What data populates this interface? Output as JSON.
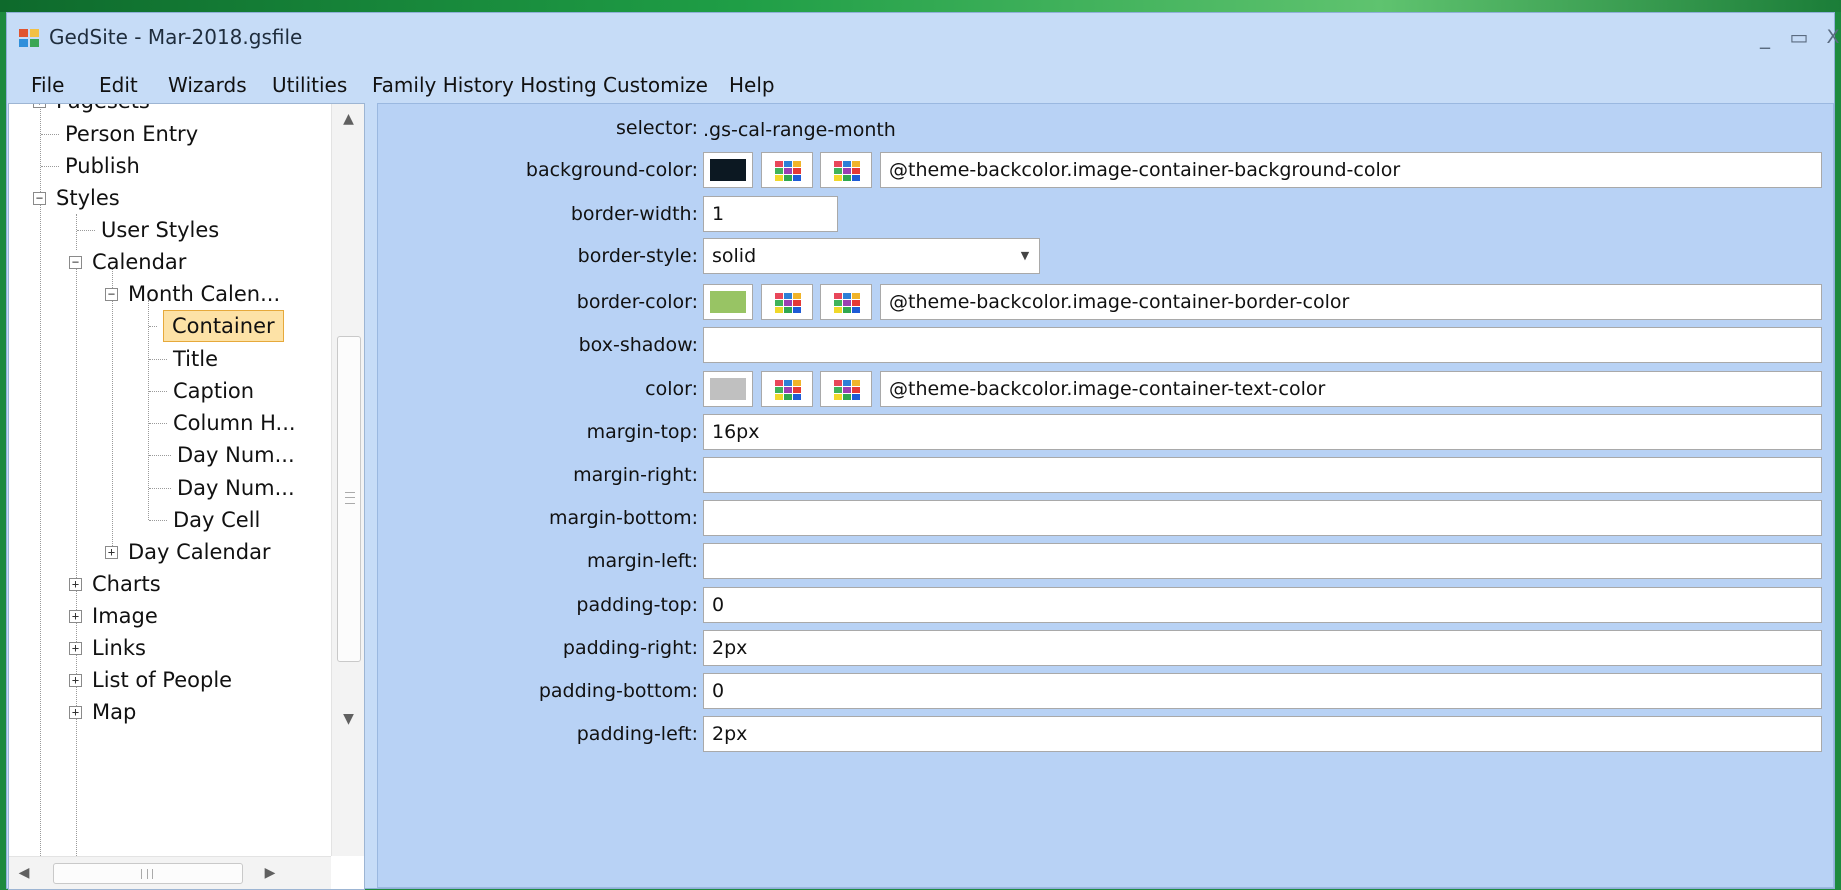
{
  "window": {
    "title": "GedSite - Mar-2018.gsfile",
    "minimize_glyph": "_",
    "maximize_glyph": "▭",
    "close_glyph": "X"
  },
  "menu": [
    "File",
    "Edit",
    "Wizards",
    "Utilities",
    "Family History Hosting",
    "Customize",
    "Help"
  ],
  "tree": {
    "partial_top": "Pagesets",
    "items": {
      "person_entry": "Person Entry",
      "publish": "Publish",
      "styles": "Styles",
      "user_styles": "User Styles",
      "calendar": "Calendar",
      "month_calendar": "Month Calen...",
      "container": "Container",
      "title": "Title",
      "caption": "Caption",
      "column_h": "Column H...",
      "day_num_1": "Day Num...",
      "day_num_2": "Day Num...",
      "day_cell": "Day Cell",
      "day_calendar": "Day Calendar",
      "charts": "Charts",
      "image": "Image",
      "links": "Links",
      "list_of_people": "List of People",
      "map": "Map"
    },
    "expanded_glyph": "−",
    "collapsed_glyph": "+"
  },
  "properties": {
    "selector_label": "selector:",
    "selector_value": ".gs-cal-range-month",
    "background_color": {
      "label": "background-color:",
      "swatch": "#0c1822",
      "value": "@theme-backcolor.image-container-background-color"
    },
    "border_width": {
      "label": "border-width:",
      "value": "1"
    },
    "border_style": {
      "label": "border-style:",
      "value": "solid"
    },
    "border_color": {
      "label": "border-color:",
      "swatch": "#98c464",
      "value": "@theme-backcolor.image-container-border-color"
    },
    "box_shadow": {
      "label": "box-shadow:",
      "value": ""
    },
    "color": {
      "label": "color:",
      "swatch": "#c0c0c0",
      "value": "@theme-backcolor.image-container-text-color"
    },
    "margin_top": {
      "label": "margin-top:",
      "value": "16px"
    },
    "margin_right": {
      "label": "margin-right:",
      "value": ""
    },
    "margin_bottom": {
      "label": "margin-bottom:",
      "value": ""
    },
    "margin_left": {
      "label": "margin-left:",
      "value": ""
    },
    "padding_top": {
      "label": "padding-top:",
      "value": "0"
    },
    "padding_right": {
      "label": "padding-right:",
      "value": "2px"
    },
    "padding_bottom": {
      "label": "padding-bottom:",
      "value": "0"
    },
    "padding_left": {
      "label": "padding-left:",
      "value": "2px"
    }
  },
  "palette_colors": [
    "#e8475a",
    "#2d7fd6",
    "#f0b429",
    "#3fb35a",
    "#9b3fb3",
    "#e53935",
    "#f0d82a",
    "#2fa84f",
    "#1e5bd6"
  ],
  "colors": {
    "window_bg": "#c6dcf7",
    "props_bg": "#b8d2f5",
    "selection_bg": "#fde2a6",
    "selection_border": "#e6a93b"
  }
}
